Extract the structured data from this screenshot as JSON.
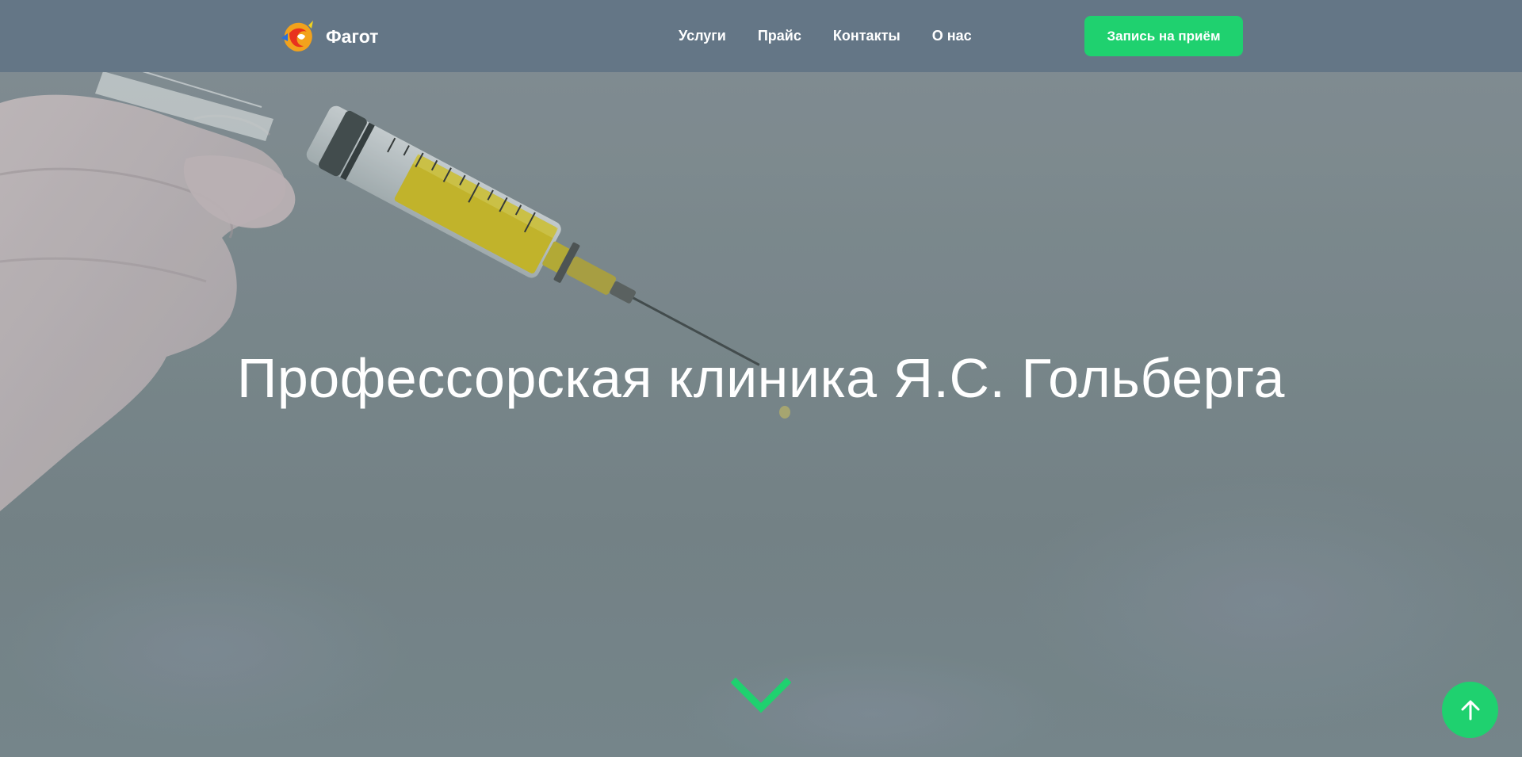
{
  "header": {
    "brand_name": "Фагот",
    "logo_icon": "fox-logo-icon",
    "nav": [
      {
        "label": "Услуги"
      },
      {
        "label": "Прайс"
      },
      {
        "label": "Контакты"
      },
      {
        "label": "О нас"
      }
    ],
    "cta_label": "Запись на приём"
  },
  "hero": {
    "title": "Профессорская клиника Я.С. Гольберга",
    "background_image": "syringe-image",
    "scroll_down_icon": "chevron-down-icon"
  },
  "scroll_top_icon": "arrow-up-icon",
  "colors": {
    "accent": "#1fd16f",
    "header_bg": "#627485",
    "text": "#ffffff"
  }
}
